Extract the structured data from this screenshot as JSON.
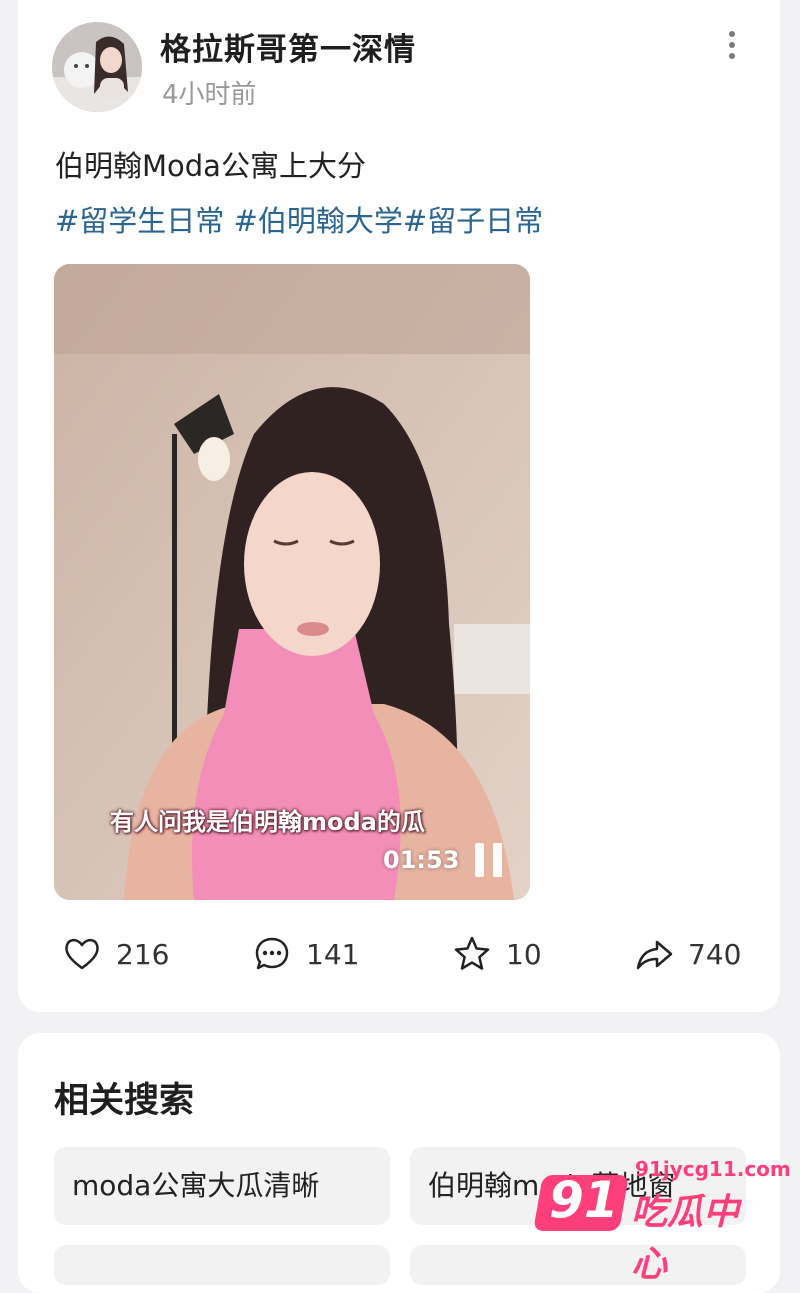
{
  "post": {
    "username": "格拉斯哥第一深情",
    "time": "4小时前",
    "title": "伯明翰Moda公寓上大分",
    "hashtags": [
      "#留学生日常",
      "#伯明翰大学",
      "#留子日常"
    ],
    "video": {
      "subtitle": "有人问我是伯明翰moda的瓜",
      "duration": "01:53"
    },
    "actions": {
      "likes": "216",
      "comments": "141",
      "favorites": "10",
      "shares": "740"
    }
  },
  "related": {
    "title": "相关搜索",
    "items": [
      "moda公寓大瓜清晰",
      "伯明翰moda落地窗"
    ]
  },
  "watermark": {
    "number": "91",
    "url": "91jycg11.com",
    "text": "吃瓜中心"
  },
  "icons": [
    "more-icon",
    "pause-icon",
    "heart-icon",
    "comment-icon",
    "star-icon",
    "share-icon"
  ],
  "colors": {
    "hashtag": "#2b6592",
    "watermark": "#ff3f7c"
  }
}
